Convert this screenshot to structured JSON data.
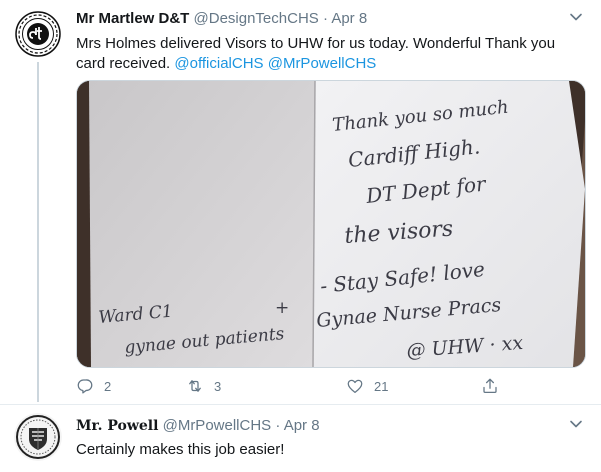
{
  "tweet1": {
    "author_name": "Mr Martlew D&T",
    "author_handle": "@DesignTechCHS",
    "separator": "·",
    "date": "Apr 8",
    "text_plain": "Mrs Holmes delivered Visors to UHW for us today. Wonderful Thank you card received. ",
    "mention1": "@officialCHS",
    "mention2": "@MrPowellCHS",
    "card_text": {
      "line1": "Thank you so much",
      "line2": "Cardiff High.",
      "line3": "DT Dept for",
      "line4": "the visors",
      "line5": "- Stay Safe! love",
      "line6": "Gynae Nurse Pracs",
      "line7": "@ UHW · xx",
      "left1": "Ward C1",
      "left1_plus": "+",
      "left2": "gynae out patients"
    },
    "reply_count": "2",
    "retweet_count": "3",
    "like_count": "21"
  },
  "tweet2": {
    "author_name": "Mr. Powell",
    "author_handle": "@MrPowellCHS",
    "separator": "·",
    "date": "Apr 8",
    "text": "Certainly makes this job easier!"
  },
  "colors": {
    "link": "#1b95e0",
    "muted": "#657786",
    "divider": "#e6ecf0"
  },
  "icons": [
    "dt-logo-avatar",
    "school-crest-avatar",
    "chevron-down-icon",
    "reply-icon",
    "retweet-icon",
    "heart-icon",
    "share-icon"
  ]
}
